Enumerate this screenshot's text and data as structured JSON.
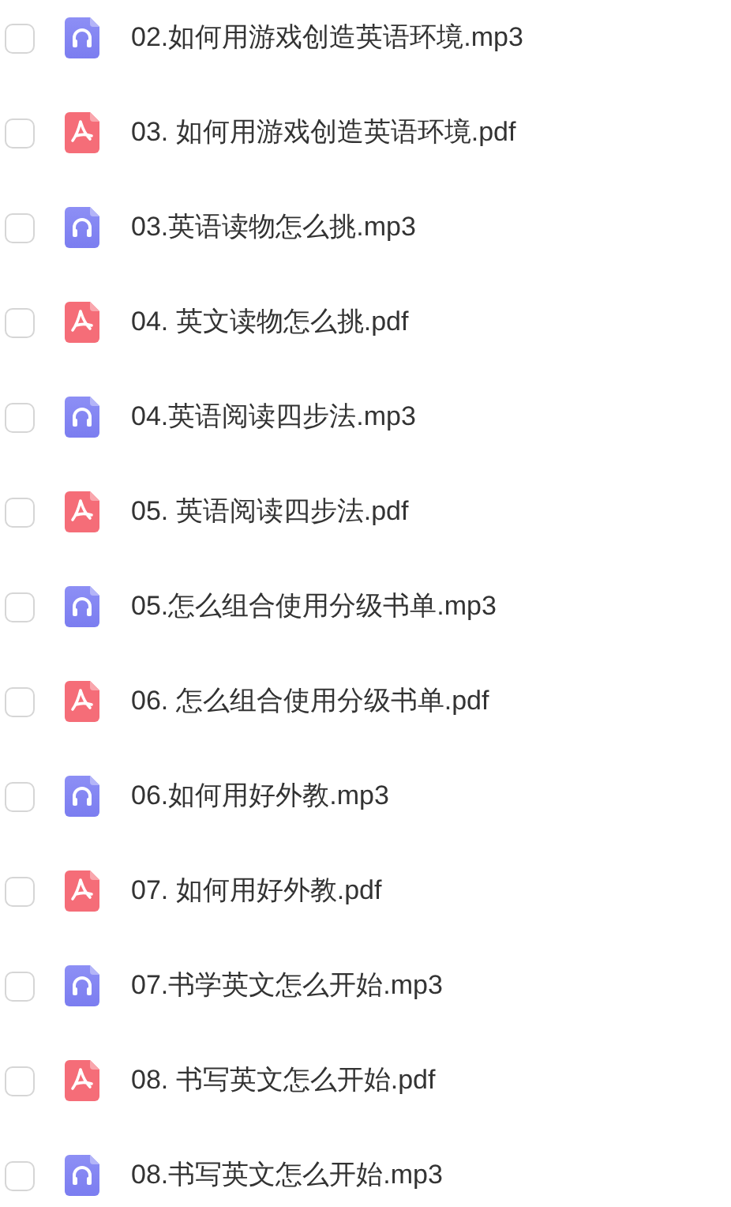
{
  "files": [
    {
      "name": "02.如何用游戏创造英语环境.mp3",
      "kind": "audio",
      "checked": false
    },
    {
      "name": "03. 如何用游戏创造英语环境.pdf",
      "kind": "pdf",
      "checked": false
    },
    {
      "name": "03.英语读物怎么挑.mp3",
      "kind": "audio",
      "checked": false
    },
    {
      "name": "04. 英文读物怎么挑.pdf",
      "kind": "pdf",
      "checked": false
    },
    {
      "name": "04.英语阅读四步法.mp3",
      "kind": "audio",
      "checked": false
    },
    {
      "name": "05. 英语阅读四步法.pdf",
      "kind": "pdf",
      "checked": false
    },
    {
      "name": "05.怎么组合使用分级书单.mp3",
      "kind": "audio",
      "checked": false
    },
    {
      "name": "06. 怎么组合使用分级书单.pdf",
      "kind": "pdf",
      "checked": false
    },
    {
      "name": "06.如何用好外教.mp3",
      "kind": "audio",
      "checked": false
    },
    {
      "name": "07. 如何用好外教.pdf",
      "kind": "pdf",
      "checked": false
    },
    {
      "name": "07.书学英文怎么开始.mp3",
      "kind": "audio",
      "checked": false
    },
    {
      "name": "08. 书写英文怎么开始.pdf",
      "kind": "pdf",
      "checked": false
    },
    {
      "name": "08.书写英文怎么开始.mp3",
      "kind": "audio",
      "checked": false
    }
  ]
}
